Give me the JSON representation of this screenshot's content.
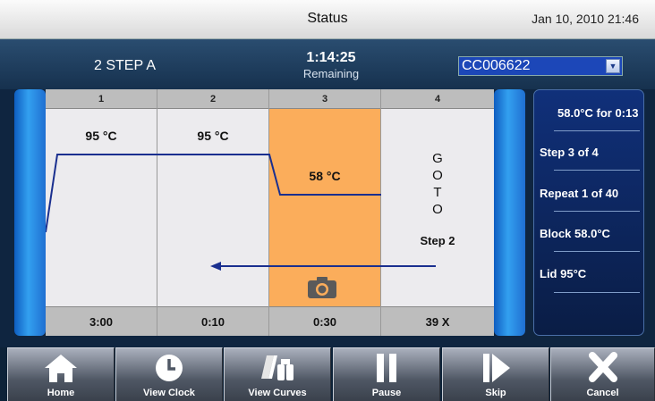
{
  "topbar": {
    "title": "Status",
    "datetime": "Jan 10, 2010 21:46"
  },
  "header": {
    "protocol": "2 STEP A",
    "time_remaining": "1:14:25",
    "remaining_label": "Remaining",
    "selector": {
      "value": "CC006622"
    }
  },
  "steps": [
    {
      "number": "1",
      "temp": "95 °C",
      "time": "3:00"
    },
    {
      "number": "2",
      "temp": "95 °C",
      "time": "0:10"
    },
    {
      "number": "3",
      "temp": "58 °C",
      "time": "0:30",
      "active": true
    },
    {
      "number": "4",
      "goto_letters": [
        "G",
        "O",
        "T",
        "O"
      ],
      "goto_target": "Step 2",
      "cycles": "39 X"
    }
  ],
  "info": [
    {
      "text": "58.0°C for 0:13"
    },
    {
      "text": "Step 3 of 4"
    },
    {
      "text": "Repeat 1 of 40"
    },
    {
      "text": "Block 58.0°C"
    },
    {
      "text": "Lid 95°C"
    }
  ],
  "toolbar": {
    "home": "Home",
    "view_clock": "View Clock",
    "view_curves": "View Curves",
    "pause": "Pause",
    "skip": "Skip",
    "cancel": "Cancel"
  },
  "colors": {
    "active_step": "#fbad5b",
    "profile_line": "#1a2f8f",
    "selector_bg": "#1c47b8",
    "info_panel": "#10307a"
  },
  "icons": [
    "camera-icon",
    "home-icon",
    "clock-icon",
    "curves-icon",
    "pause-icon",
    "skip-icon",
    "cancel-icon",
    "chevron-down-icon"
  ]
}
